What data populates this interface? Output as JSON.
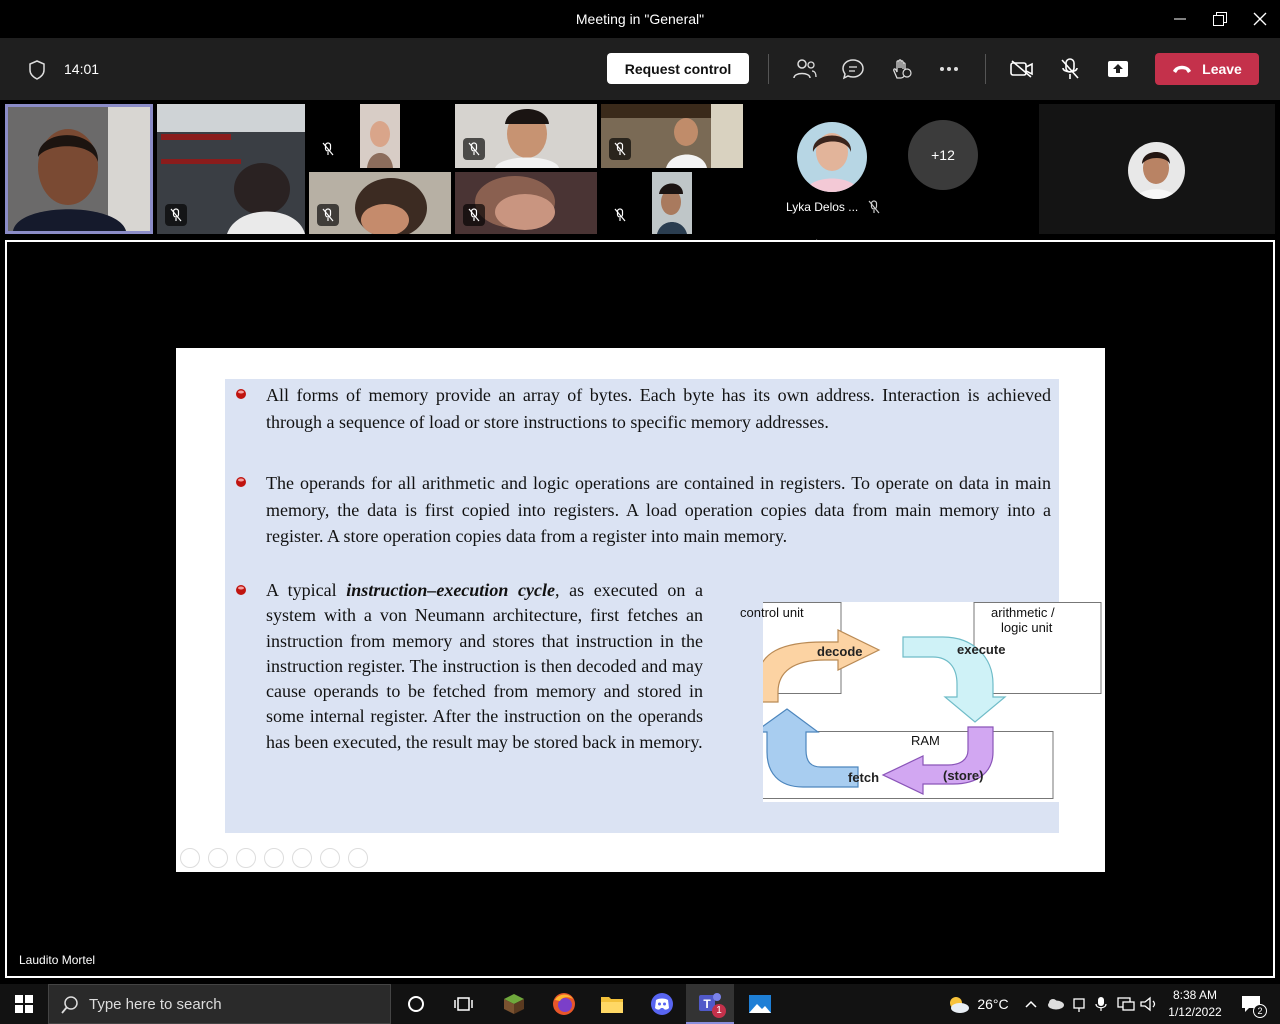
{
  "window": {
    "title": "Meeting in \"General\""
  },
  "toolbar": {
    "timer": "14:01",
    "request_control_label": "Request control",
    "leave_label": "Leave"
  },
  "participants": {
    "named_label": "Lyka Delos ...",
    "overflow_count": "+12"
  },
  "shared_screen": {
    "presenter_name": "Laudito Mortel",
    "slide": {
      "bullet1": "All forms of memory provide an array of bytes. Each byte has its own address. Interaction is achieved through a sequence of load or store instructions to specific memory addresses.",
      "bullet2": "The operands for all arithmetic and logic operations are contained in registers. To operate on data in main memory, the data is first copied into registers. A load operation copies data from main memory into a register. A store operation copies data from a register into main memory.",
      "bullet3_prefix": "A typical ",
      "bullet3_emphasis": "instruction–execution cycle",
      "bullet3_rest": ", as executed on a system with a von Neumann architecture, first fetches an instruction from memory and stores that instruction in the instruction register. The instruction is then decoded and may cause operands to be fetched from memory and stored in some internal register. After the instruction on the operands has been executed, the result may be stored back in memory.",
      "diagram": {
        "control_unit": "control unit",
        "alu_line1": "arithmetic /",
        "alu_line2": "logic unit",
        "ram": "RAM",
        "decode": "decode",
        "execute": "execute",
        "fetch": "fetch",
        "store": "(store)"
      }
    }
  },
  "taskbar": {
    "search_placeholder": "Type here to search",
    "weather": "26°C",
    "time": "8:38 AM",
    "date": "1/12/2022",
    "teams_badge": "1",
    "notification_count": "2"
  }
}
